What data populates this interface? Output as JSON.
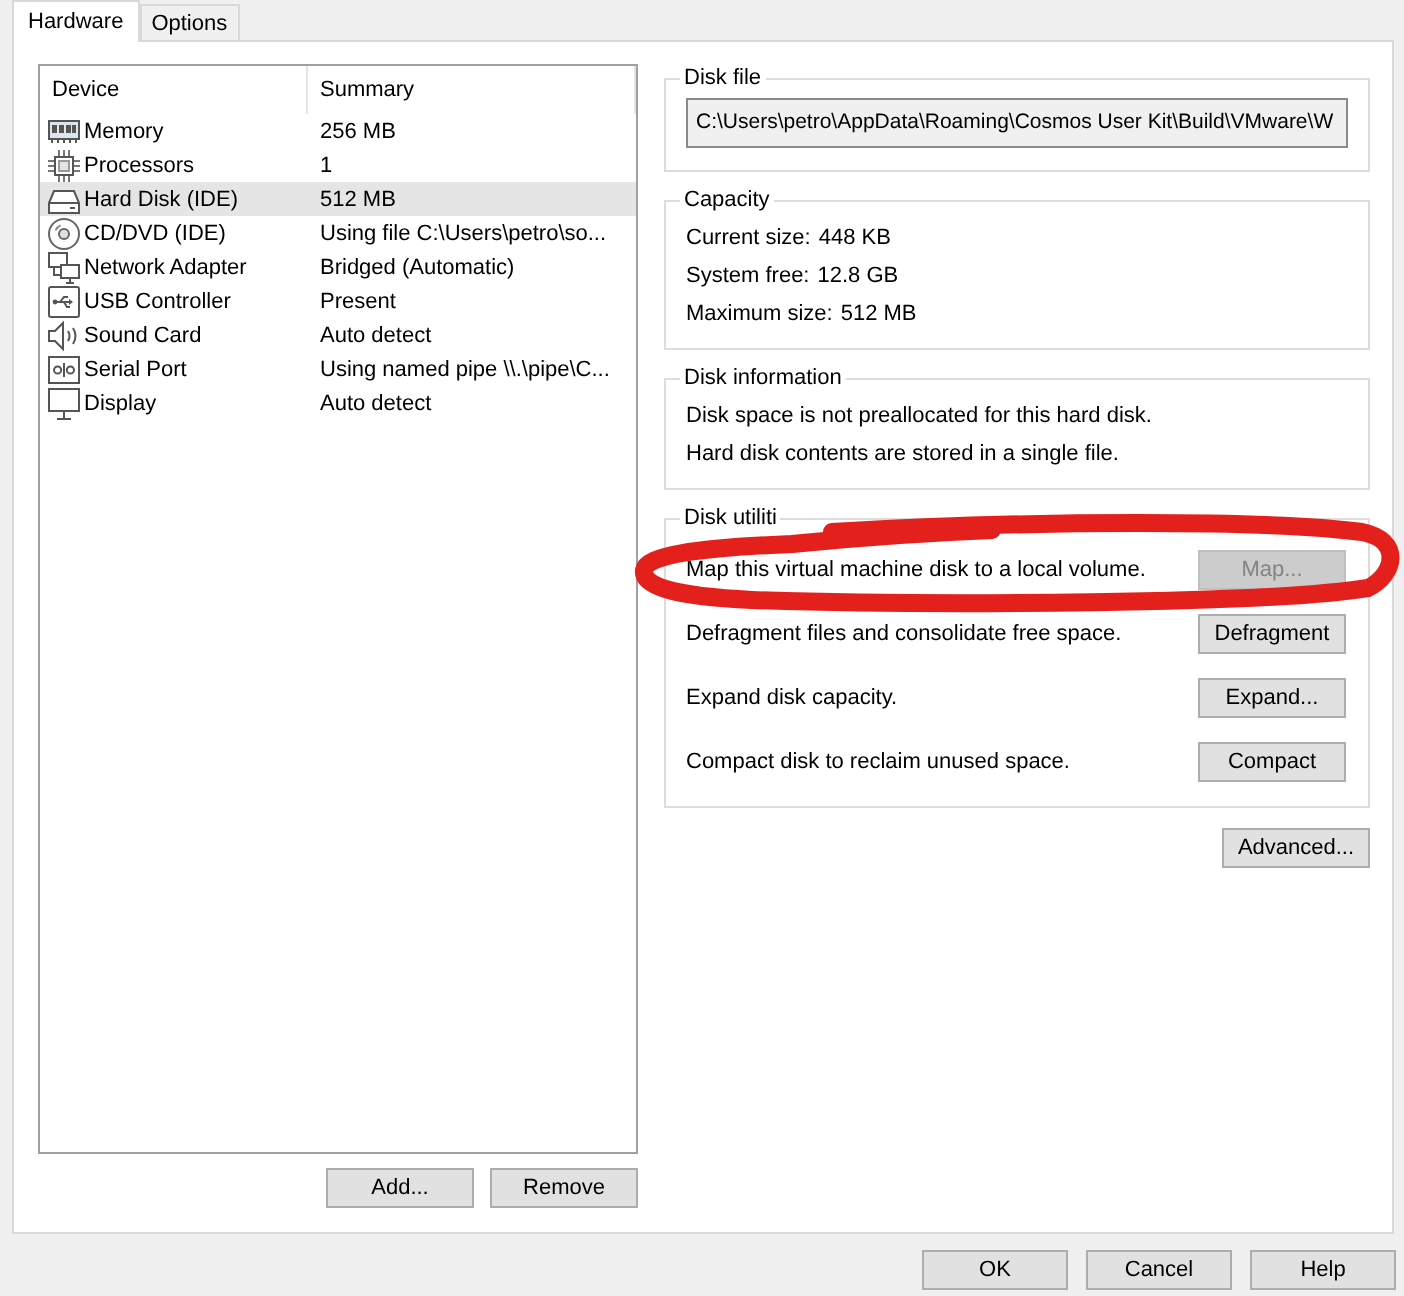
{
  "tabs": [
    {
      "label": "Hardware",
      "selected": true
    },
    {
      "label": "Options",
      "selected": false
    }
  ],
  "device_list": {
    "columns": [
      "Device",
      "Summary"
    ],
    "rows": [
      {
        "kind": "memory",
        "device": "Memory",
        "summary": "256 MB",
        "selected": false
      },
      {
        "kind": "processor",
        "device": "Processors",
        "summary": "1",
        "selected": false
      },
      {
        "kind": "hard_disk",
        "device": "Hard Disk (IDE)",
        "summary": "512 MB",
        "selected": true
      },
      {
        "kind": "cd",
        "device": "CD/DVD (IDE)",
        "summary": "Using file C:\\Users\\petro\\so...",
        "selected": false
      },
      {
        "kind": "network",
        "device": "Network Adapter",
        "summary": "Bridged (Automatic)",
        "selected": false
      },
      {
        "kind": "usb",
        "device": "USB Controller",
        "summary": "Present",
        "selected": false
      },
      {
        "kind": "sound",
        "device": "Sound Card",
        "summary": "Auto detect",
        "selected": false
      },
      {
        "kind": "serial",
        "device": "Serial Port",
        "summary": "Using named pipe \\\\.\\pipe\\C...",
        "selected": false
      },
      {
        "kind": "display",
        "device": "Display",
        "summary": "Auto detect",
        "selected": false
      }
    ],
    "add_button": "Add...",
    "remove_button": "Remove"
  },
  "disk_file": {
    "title": "Disk file",
    "value": "C:\\Users\\petro\\AppData\\Roaming\\Cosmos User Kit\\Build\\VMware\\W"
  },
  "capacity": {
    "title": "Capacity",
    "items": [
      {
        "label": "Current size:",
        "value": "448 KB"
      },
      {
        "label": "System free:",
        "value": "12.8 GB"
      },
      {
        "label": "Maximum size:",
        "value": "512 MB"
      }
    ]
  },
  "disk_information": {
    "title": "Disk information",
    "lines": [
      "Disk space is not preallocated for this hard disk.",
      "Hard disk contents are stored in a single file."
    ]
  },
  "disk_utilities": {
    "title": "Disk utiliti",
    "rows": [
      {
        "description": "Map this virtual machine disk to a local volume.",
        "button": "Map...",
        "disabled": true,
        "circled": true
      },
      {
        "description": "Defragment files and consolidate free space.",
        "button": "Defragment",
        "disabled": false,
        "circled": false
      },
      {
        "description": "Expand disk capacity.",
        "button": "Expand...",
        "disabled": false,
        "circled": false
      },
      {
        "description": "Compact disk to reclaim unused space.",
        "button": "Compact",
        "disabled": false,
        "circled": false
      }
    ]
  },
  "advanced_button": "Advanced...",
  "dialog_buttons": {
    "ok": "OK",
    "cancel": "Cancel",
    "help": "Help"
  }
}
